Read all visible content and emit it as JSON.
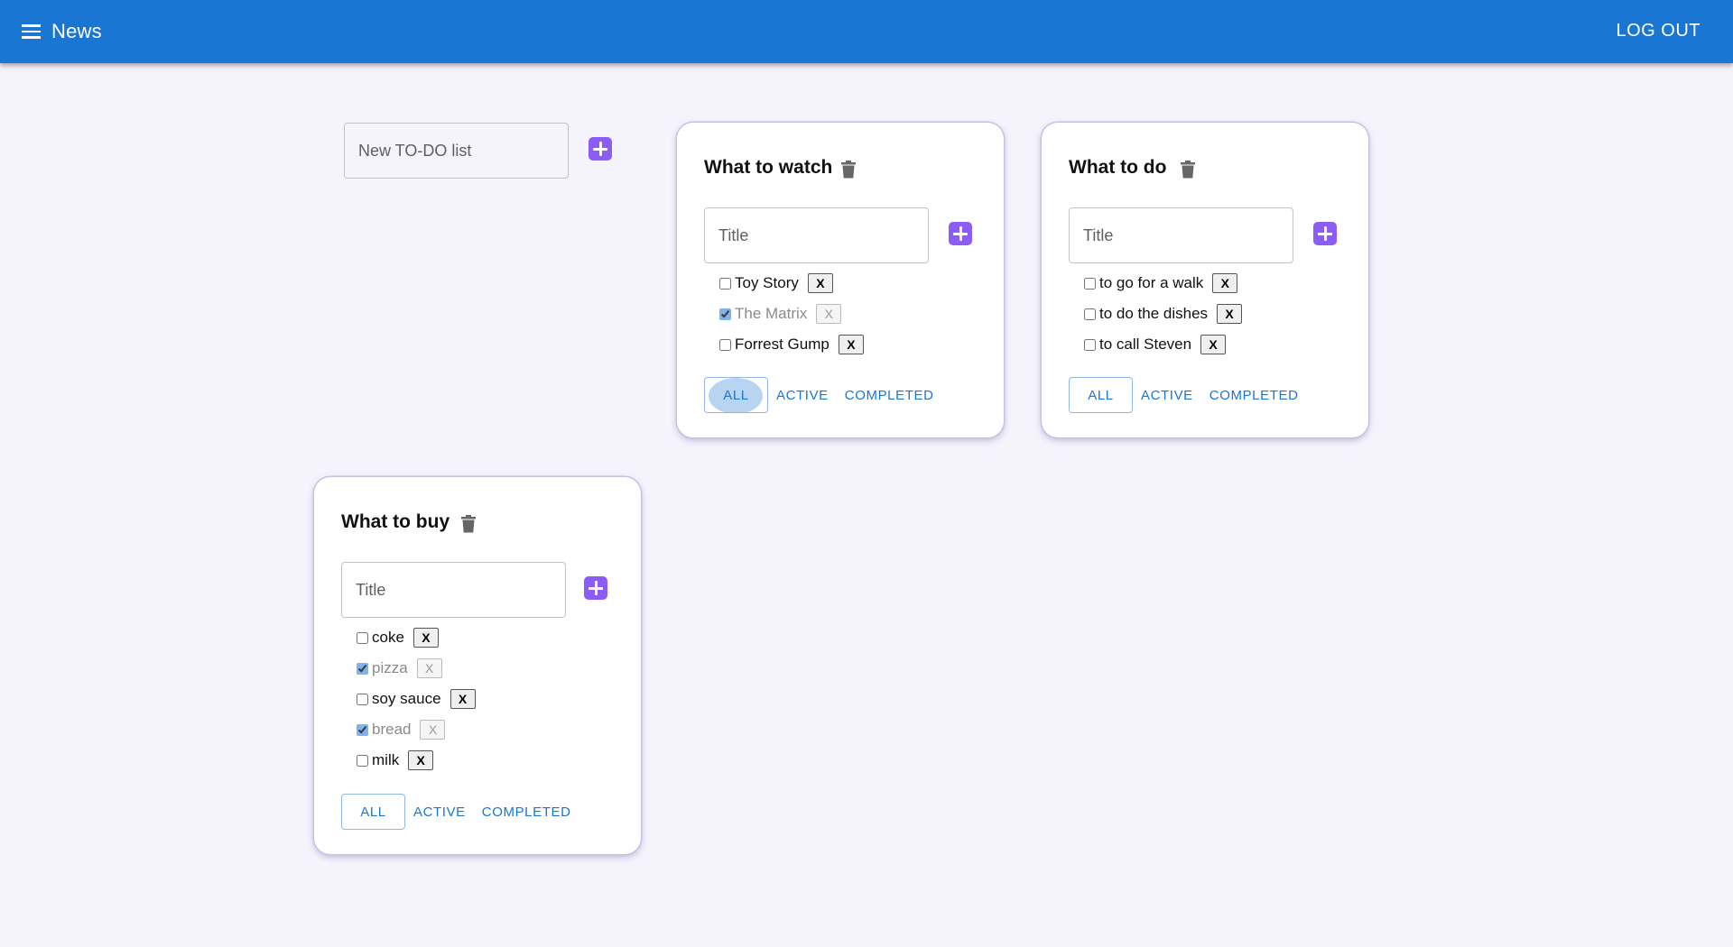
{
  "appbar": {
    "title": "News",
    "logout_label": "LOG OUT",
    "color": "#1976d2"
  },
  "new_list": {
    "placeholder": "New TO-DO list",
    "accent": "#8b5cf6"
  },
  "lists": [
    {
      "title": "What to watch",
      "input_placeholder": "Title",
      "tasks": [
        {
          "label": "Toy Story",
          "done": false,
          "delete_label": "X"
        },
        {
          "label": "The Matrix",
          "done": true,
          "delete_label": "X"
        },
        {
          "label": "Forrest Gump",
          "done": false,
          "delete_label": "X"
        }
      ],
      "filters": [
        "ALL",
        "ACTIVE",
        "COMPLETED"
      ],
      "selected_filter": "ALL"
    },
    {
      "title": "What to do",
      "input_placeholder": "Title",
      "tasks": [
        {
          "label": "to go for a walk",
          "done": false,
          "delete_label": "X"
        },
        {
          "label": "to do the dishes",
          "done": false,
          "delete_label": "X"
        },
        {
          "label": "to call Steven",
          "done": false,
          "delete_label": "X"
        }
      ],
      "filters": [
        "ALL",
        "ACTIVE",
        "COMPLETED"
      ],
      "selected_filter": "ALL"
    },
    {
      "title": "What to buy",
      "input_placeholder": "Title",
      "tasks": [
        {
          "label": "coke",
          "done": false,
          "delete_label": "X"
        },
        {
          "label": "pizza",
          "done": true,
          "delete_label": "X"
        },
        {
          "label": "soy sauce",
          "done": false,
          "delete_label": "X"
        },
        {
          "label": "bread",
          "done": true,
          "delete_label": "X"
        },
        {
          "label": "milk",
          "done": false,
          "delete_label": "X"
        }
      ],
      "filters": [
        "ALL",
        "ACTIVE",
        "COMPLETED"
      ],
      "selected_filter": "ALL"
    }
  ]
}
